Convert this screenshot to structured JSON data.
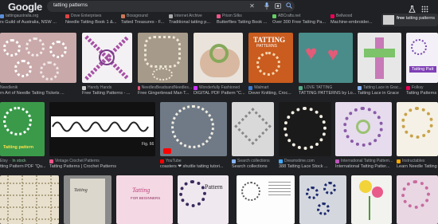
{
  "header": {
    "logo": "Google",
    "query": "tatting patterns",
    "clear_icon": "close-icon",
    "mic_icon": "microphone-icon",
    "lens_icon": "camera-icon",
    "search_icon": "search-icon"
  },
  "related": [
    {
      "source": "tattingaustralia.org",
      "title": "rs Guild of Australia, NSW ..."
    },
    {
      "source": "Dove Enterprises",
      "title": "Needle Tatting Book 1 &..."
    },
    {
      "source": "Bossground",
      "title": "Tatted Treasures - F..."
    },
    {
      "source": "Internet Archive",
      "title": "Traditional tatting p..."
    },
    {
      "source": "Prism Silks",
      "title": "Butterflies Tatting Book ..."
    },
    {
      "source": "ABCrafts.net",
      "title": "Over 300 Free Tatting Pa..."
    },
    {
      "source": "Bellwood",
      "title": "Machine-embroider..."
    }
  ],
  "related_chip": {
    "bold": "free",
    "rest": "tatting patterns"
  },
  "row1": [
    {
      "source": "Needlenik",
      "title": "rn Art of Needle Tatting Tickets ..."
    },
    {
      "source": "Handy Hands",
      "title": "Free Tatting Patterns - ..."
    },
    {
      "source": "NeedlesBeadsandNeedles...",
      "title": "Free Gingerbread Man T..."
    },
    {
      "source": "Wonderfully Fashioned",
      "title": "DIGITAL PDF Pattern \"C..."
    },
    {
      "source": "Walmart",
      "title": "Dover Knitting, Croc..."
    },
    {
      "source": "LOVE TATTING",
      "title": "TATTING PATTERNS by Lo..."
    },
    {
      "source": "Tatting Lace in Grac...",
      "title": "Tatting Lace in Grace"
    },
    {
      "source": "Folksy",
      "title": "Tatting Patterns"
    }
  ],
  "row2": [
    {
      "source": "Etsy",
      "stock": "In stock",
      "title": "tting Pattern PDF \"Qu..."
    },
    {
      "source": "Vintage Crochet Patterns",
      "title": "Tatting Patterns | Crochet Patterns"
    },
    {
      "source": "YouTube",
      "title": "coasters ❤ shuttle tatting tutori..."
    },
    {
      "source": "Search collections",
      "title": "Search collections"
    },
    {
      "source": "Dreamstime.com",
      "title": "388 Tatting Lace Stock ..."
    },
    {
      "source": "International Tatting Pattern...",
      "title": "International Tatting Patter..."
    },
    {
      "source": "Instructables",
      "title": "Learn Needle Tatting"
    }
  ],
  "book_cover": {
    "tatting_title": "TATTING",
    "tatting_sub": "PATTERNS",
    "fig": "Fig. 66",
    "pattern_word": "Pattern",
    "tatting_word": "Tatting",
    "forbeg": "FOR BEGINNERS",
    "chip_text": "Tatting Patt"
  },
  "colors": {
    "bg": "#202124",
    "search_bg": "#303134",
    "accent_green": "#81c995"
  }
}
